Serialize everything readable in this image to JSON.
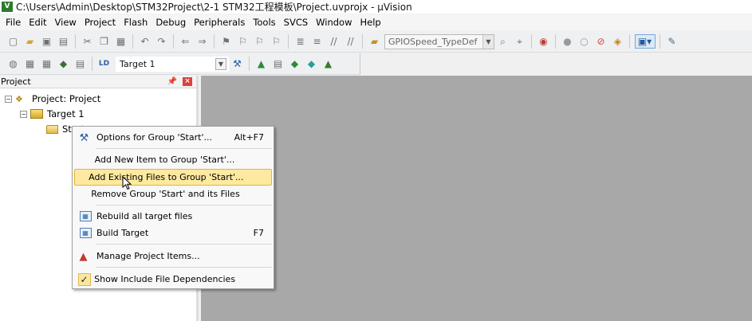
{
  "window": {
    "title": "C:\\Users\\Admin\\Desktop\\STM32Project\\2-1 STM32工程模板\\Project.uvprojx - µVision",
    "app_icon_letter": "V"
  },
  "menu": {
    "items": [
      "File",
      "Edit",
      "View",
      "Project",
      "Flash",
      "Debug",
      "Peripherals",
      "Tools",
      "SVCS",
      "Window",
      "Help"
    ]
  },
  "toolbar": {
    "search_combo_value": "GPIOSpeed_TypeDef",
    "target_combo_value": "Target 1",
    "icons": [
      "new-file",
      "open-file",
      "save",
      "save-all",
      "cut",
      "copy",
      "paste",
      "undo",
      "redo",
      "navigate-back",
      "navigate-forward",
      "insert-bookmark",
      "previous-bookmark",
      "next-bookmark",
      "clear-bookmarks",
      "indent",
      "unindent",
      "comment",
      "uncomment",
      "find-in-files",
      "find",
      "incremental-find",
      "debug-session",
      "breakpoint",
      "disable-breakpoint",
      "kill-breakpoints",
      "disable-all-breakpoints",
      "window-layout",
      "configure"
    ],
    "icons2": [
      "translate",
      "build",
      "rebuild",
      "batch-build",
      "stop-build",
      "download",
      "options-for-target",
      "manage-components",
      "select-packs",
      "pack-installer",
      "run-time-env"
    ]
  },
  "project_panel": {
    "title": "Project",
    "tree": {
      "project": "Project: Project",
      "target": "Target 1",
      "group": "Start"
    }
  },
  "context_menu": {
    "items": [
      {
        "label": "Options for Group 'Start'...",
        "shortcut": "Alt+F7",
        "icon": "options-icon"
      },
      {
        "label": "Add New  Item to Group 'Start'...",
        "shortcut": "",
        "icon": ""
      },
      {
        "label": "Add Existing Files to Group 'Start'...",
        "shortcut": "",
        "icon": "",
        "highlighted": true
      },
      {
        "label": "Remove Group 'Start' and its Files",
        "shortcut": "",
        "icon": ""
      },
      {
        "label": "Rebuild all target files",
        "shortcut": "",
        "icon": "rebuild-icon"
      },
      {
        "label": "Build Target",
        "shortcut": "F7",
        "icon": "build-icon"
      },
      {
        "label": "Manage Project Items...",
        "shortcut": "",
        "icon": "manage-items-icon"
      },
      {
        "label": "Show Include File Dependencies",
        "shortcut": "",
        "icon": "checkmark-icon",
        "checked": true
      }
    ]
  },
  "colors": {
    "highlight_bg": "#fde9a0",
    "highlight_border": "#e6b33a",
    "workspace_bg": "#a8a8a8",
    "close_button": "#d9433a"
  }
}
